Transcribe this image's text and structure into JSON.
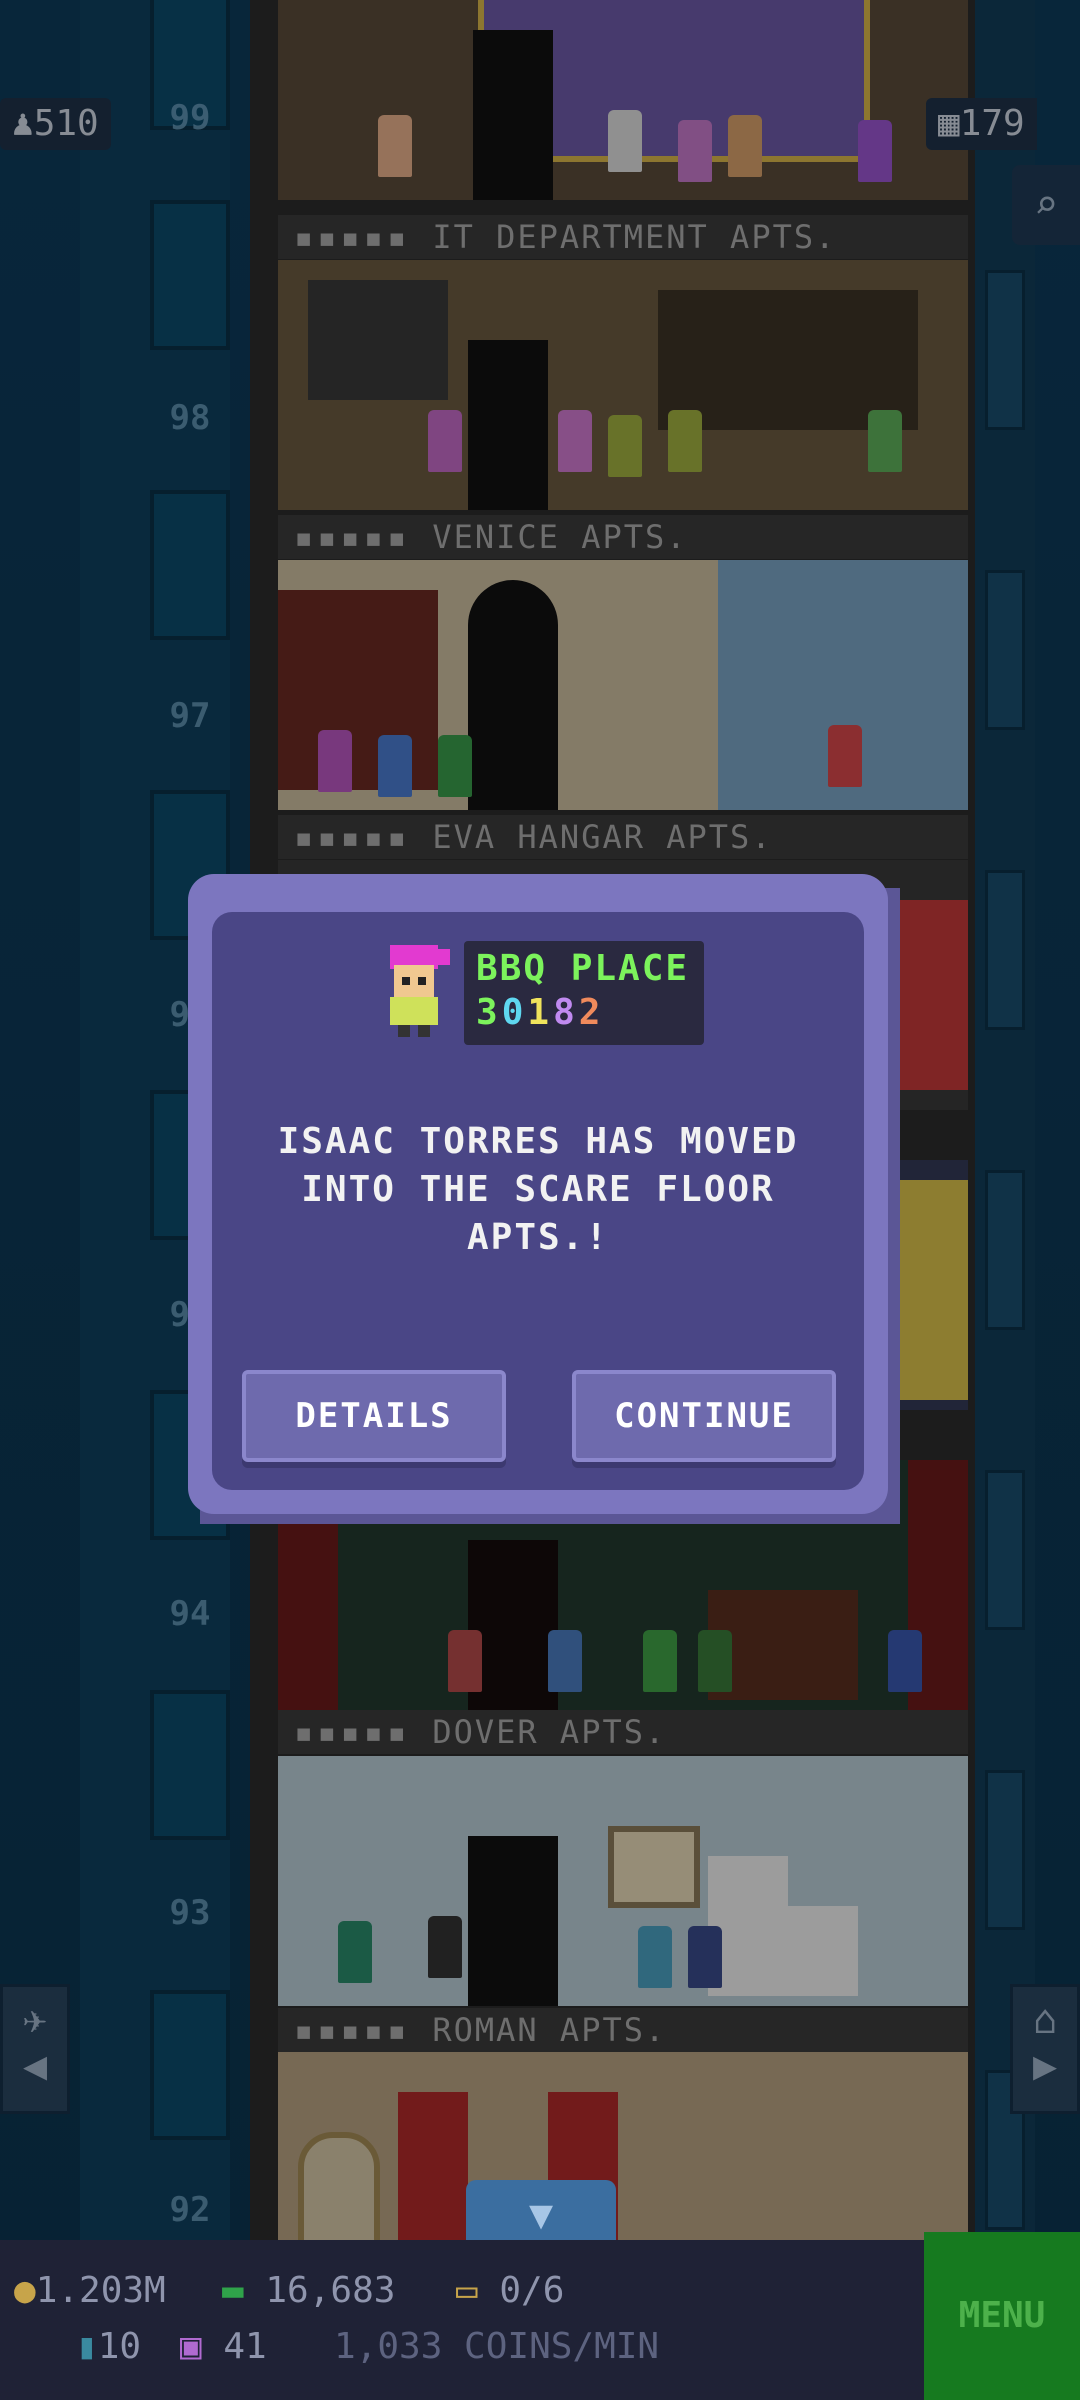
{
  "hud": {
    "population": "510",
    "floors": "179"
  },
  "floors": [
    {
      "number": "99",
      "label": "IT DEPARTMENT APTS."
    },
    {
      "number": "98",
      "label": "VENICE APTS."
    },
    {
      "number": "97",
      "label": "EVA HANGAR APTS."
    },
    {
      "number": "96",
      "label": ""
    },
    {
      "number": "95",
      "label": ""
    },
    {
      "number": "94",
      "label": "DOVER APTS."
    },
    {
      "number": "93",
      "label": "ROMAN APTS."
    },
    {
      "number": "92",
      "label": ""
    }
  ],
  "modal": {
    "shop_name": "BBQ PLACE",
    "shop_code": [
      "3",
      "0",
      "1",
      "8",
      "2"
    ],
    "code_colors": [
      "#7cf35c",
      "#5fd7f0",
      "#f0e35c",
      "#c08af0",
      "#f08a5c"
    ],
    "message_lines": [
      "ISAAC TORRES HAS MOVED",
      "INTO THE SCARE FLOOR",
      "APTS.!"
    ],
    "details_label": "DETAILS",
    "continue_label": "CONTINUE"
  },
  "bottom_bar": {
    "coins": "1.203M",
    "bux": "16,683",
    "tickets": "0/6",
    "bitizens": "10",
    "tv": "41",
    "rate": "1,033 COINS/MIN",
    "menu_label": "MENU"
  },
  "colors": {
    "modal_outer": "#7c76bf",
    "modal_inner": "#4a4686",
    "menu_green": "#167a1f"
  }
}
